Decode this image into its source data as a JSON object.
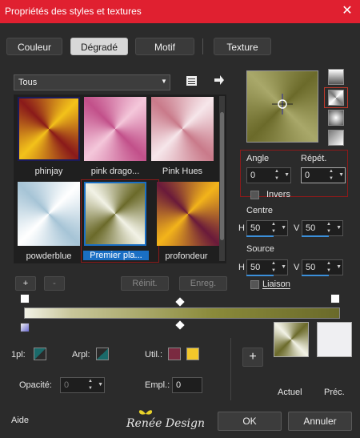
{
  "window": {
    "title": "Propriétés des styles et textures",
    "close": "✕"
  },
  "tabs": [
    {
      "label": "Couleur"
    },
    {
      "label": "Dégradé"
    },
    {
      "label": "Motif"
    },
    {
      "label": "Texture"
    }
  ],
  "category": {
    "selected": "Tous"
  },
  "gradients": [
    {
      "label": "phinjay"
    },
    {
      "label": "pink drago..."
    },
    {
      "label": "Pink Hues"
    },
    {
      "label": "powderblue"
    },
    {
      "label": "Premier pla..."
    },
    {
      "label": "profondeur"
    }
  ],
  "list_buttons": {
    "add": "+",
    "remove": "-",
    "reset": "Réinit.",
    "save": "Enreg."
  },
  "angle": {
    "label": "Angle",
    "value": "0"
  },
  "repeat": {
    "label": "Répét.",
    "value": "0"
  },
  "invert": {
    "label": "Invers"
  },
  "centre": {
    "label": "Centre",
    "h_label": "H",
    "h_value": "50",
    "v_label": "V",
    "v_value": "50"
  },
  "source": {
    "label": "Source",
    "h_label": "H",
    "h_value": "50",
    "v_label": "V",
    "v_value": "50"
  },
  "link": {
    "label": "Liaison"
  },
  "stops": {
    "left": "1pl:",
    "right": "Arpl:",
    "util": "Util.:",
    "opacity_label": "Opacité:",
    "opacity_value": "0",
    "location_label": "Empl.:",
    "location_value": "0"
  },
  "current": {
    "actual_label": "Actuel",
    "prev_label": "Préc.",
    "add": "+"
  },
  "footer": {
    "help": "Aide",
    "brand": "Renée Design",
    "ok": "OK",
    "cancel": "Annuler"
  },
  "colors": {
    "title_bar": "#e02030",
    "gradient_dark": "#6b6a2a",
    "gradient_light": "#f2f2e6",
    "util_swatch": "#7a2a40",
    "util_swatch2": "#f2c82a",
    "selection": "#1a6fc4"
  }
}
